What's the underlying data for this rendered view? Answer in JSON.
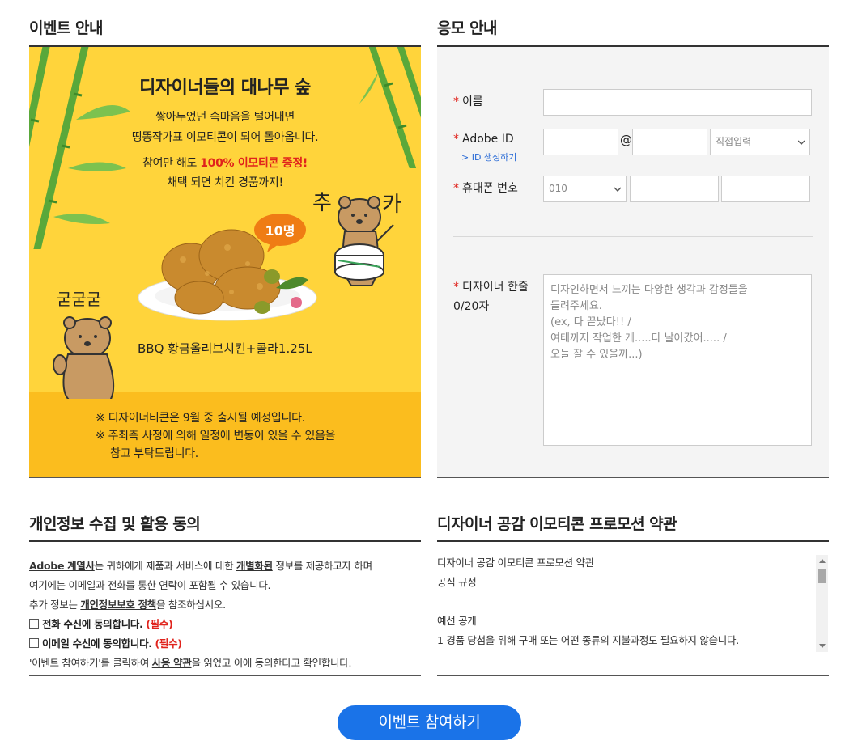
{
  "event": {
    "title": "이벤트 안내",
    "headline": "디자이너들의 대나무 숲",
    "line1": "쌓아두었던 속마음을 털어내면",
    "line2": "띵똥작가표 이모티콘이 되어 돌아옵니다.",
    "line3_prefix": "참여만 해도 ",
    "line3_highlight": "100% 이모티콘 증정!",
    "line4": "채택 되면 치킨 경품까지!",
    "badge": "10명",
    "sfx_left": "굳굳굳",
    "sfx_right1": "추",
    "sfx_right2": "카",
    "prize": "BBQ 황금올리브치킨+콜라1.25L",
    "note1": "※ 디자이너티콘은 9월 중 출시될 예정입니다.",
    "note2": "※ 주최측 사정에 의해 일정에 변동이 있을 수 있음을",
    "note3": "참고 부탁드립니다."
  },
  "form": {
    "title": "응모 안내",
    "name_label": "이름",
    "adobe_label": "Adobe ID",
    "adobe_link": "> ID 생성하기",
    "at": "@",
    "domain_select": "직접입력",
    "phone_label": "휴대폰 번호",
    "phone_prefix": "010",
    "comment_label": "디자이너 한줄",
    "comment_count": "0/20자",
    "comment_placeholder_lines": [
      "디자인하면서 느끼는 다양한 생각과 감정들을",
      "들려주세요.",
      "(ex, 다 끝났다!! /",
      "여태까지 작업한 게.....다 날아갔어..... /",
      "오늘 잘 수 있을까...)"
    ],
    "required_mark": "*"
  },
  "privacy": {
    "title": "개인정보 수집 및 활용 동의",
    "p1_link1": "Adobe 계열사",
    "p1_a": "는 귀하에게 제품과 서비스에 대한 ",
    "p1_link2": "개별화된",
    "p1_b": " 정보를 제공하고자 하며",
    "p2": "여기에는 이메일과 전화를 통한 연락이 포함될 수 있습니다.",
    "p3_a": "추가 정보는 ",
    "p3_link": "개인정보보호 정책",
    "p3_b": "을 참조하십시오.",
    "chk_phone": "전화 수신에 동의합니다.",
    "chk_email": "이메일 수신에 동의합니다.",
    "required": "(필수)",
    "p4_a": "'이벤트 참여하기'를 클릭하여 ",
    "p4_link": "사용 약관",
    "p4_b": "을 읽었고 이에 동의한다고 확인합니다."
  },
  "terms": {
    "title": "디자이너 공감 이모티콘 프로모션 약관",
    "lines": [
      "디자이너 공감 이모티콘 프로모션 약관",
      "공식 규정",
      "",
      "예선 공개",
      "1 경품 당첨을 위해 구매 또는 어떤 종류의 지불과정도 필요하지 않습니다."
    ]
  },
  "submit_label": "이벤트 참여하기",
  "colors": {
    "accent": "#1a73e8",
    "required": "#e0231c",
    "banner": "#ffd43b",
    "banner_lower": "#fbbd1e"
  }
}
